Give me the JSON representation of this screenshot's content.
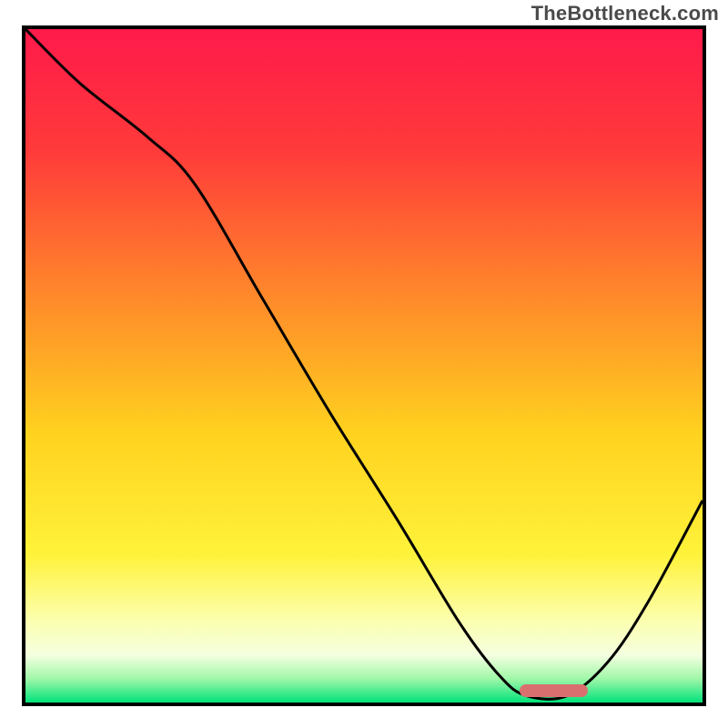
{
  "watermark": "TheBottleneck.com",
  "chart_data": {
    "type": "line",
    "title": "",
    "xlabel": "",
    "ylabel": "",
    "xlim": [
      0,
      100
    ],
    "ylim": [
      0,
      100
    ],
    "grid": false,
    "legend": false,
    "series": [
      {
        "name": "bottleneck-curve",
        "x": [
          0,
          8,
          18,
          25,
          35,
          45,
          55,
          64,
          70,
          74,
          80,
          86,
          92,
          100
        ],
        "values": [
          100,
          92,
          84,
          77,
          60,
          43,
          27,
          12,
          4,
          1,
          1,
          6,
          15,
          30
        ]
      }
    ],
    "optimal_range": {
      "start": 73,
      "end": 83,
      "color": "#d96f6f"
    },
    "gradient_stops": [
      {
        "pos": 0.0,
        "color": "#ff1a4b"
      },
      {
        "pos": 0.18,
        "color": "#ff3a3a"
      },
      {
        "pos": 0.4,
        "color": "#ff8a2a"
      },
      {
        "pos": 0.6,
        "color": "#ffd21f"
      },
      {
        "pos": 0.78,
        "color": "#fff23a"
      },
      {
        "pos": 0.88,
        "color": "#fcffb0"
      },
      {
        "pos": 0.93,
        "color": "#f4ffe0"
      },
      {
        "pos": 0.965,
        "color": "#9ff7a8"
      },
      {
        "pos": 1.0,
        "color": "#00e27a"
      }
    ]
  }
}
